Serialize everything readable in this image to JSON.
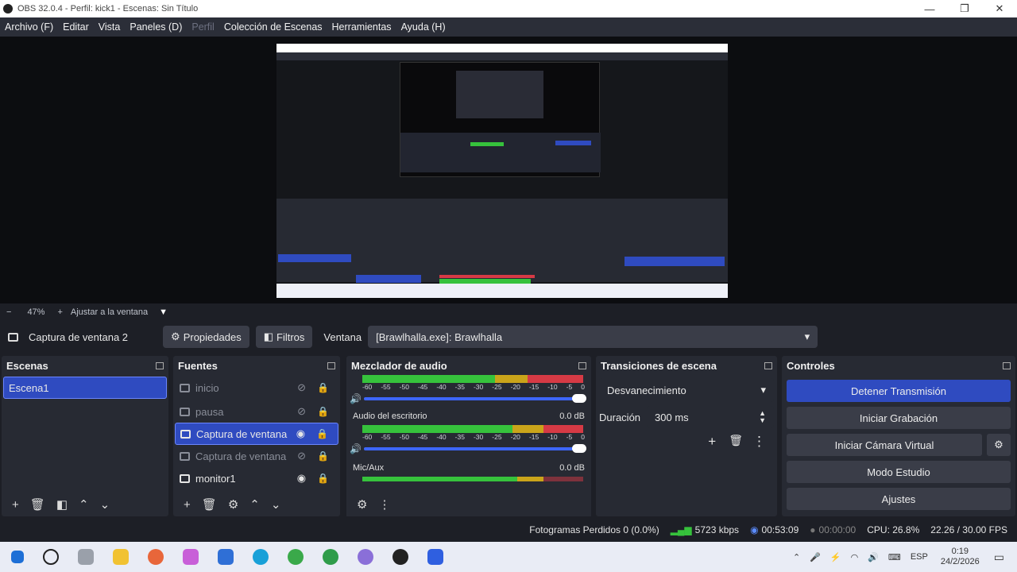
{
  "window": {
    "title": "OBS 32.0.4 - Perfil: kick1 - Escenas: Sin Título",
    "minimize": "—",
    "maximize": "❐",
    "close": "✕"
  },
  "menu": {
    "items": [
      "Archivo (F)",
      "Editar",
      "Vista",
      "Paneles (D)",
      "Perfil",
      "Colección de Escenas",
      "Herramientas",
      "Ayuda (H)"
    ]
  },
  "zoom": {
    "minus": "−",
    "value": "47%",
    "plus": "+",
    "fit_label": "Ajustar a la ventana",
    "dropdown": "▼"
  },
  "source_bar": {
    "name": "Captura de ventana 2",
    "properties": "Propiedades",
    "filters": "Filtros",
    "window_label": "Ventana",
    "window_value": "[Brawlhalla.exe]: Brawlhalla"
  },
  "scenes": {
    "title": "Escenas",
    "items": [
      "Escena1"
    ]
  },
  "sources": {
    "title": "Fuentes",
    "items": [
      {
        "name": "inicio",
        "visible": false,
        "selected": false
      },
      {
        "name": "pausa",
        "visible": false,
        "selected": false
      },
      {
        "name": "Captura de ventana",
        "visible": true,
        "selected": true
      },
      {
        "name": "Captura de ventana",
        "visible": false,
        "selected": false
      },
      {
        "name": "monitor1",
        "visible": true,
        "selected": false
      }
    ]
  },
  "mixer": {
    "title": "Mezclador de audio",
    "ticks": [
      "-60",
      "-55",
      "-50",
      "-45",
      "-40",
      "-35",
      "-30",
      "-25",
      "-20",
      "-15",
      "-10",
      "-5",
      "0"
    ],
    "channels": [
      {
        "name": "Audio del escritorio",
        "db": "0.0 dB"
      },
      {
        "name": "Mic/Aux",
        "db": "0.0 dB"
      }
    ]
  },
  "transitions": {
    "title": "Transiciones de escena",
    "selected": "Desvanecimiento",
    "duration_label": "Duración",
    "duration_value": "300 ms"
  },
  "controls": {
    "title": "Controles",
    "buttons": [
      "Detener Transmisión",
      "Iniciar Grabación",
      "Iniciar Cámara Virtual",
      "Modo Estudio",
      "Ajustes"
    ]
  },
  "status": {
    "dropped": "Fotogramas Perdidos 0 (0.0%)",
    "bitrate": "5723 kbps",
    "stream_time": "00:53:09",
    "rec_time": "00:00:00",
    "cpu": "CPU: 26.8%",
    "fps": "22.26 / 30.00 FPS"
  },
  "taskbar": {
    "lang": "ESP",
    "time": "0:19",
    "date": "24/2/2026"
  },
  "preview_mini": {
    "title": "OBS 32.0.4 - Perfil: kick1 - Escenas: Sin Título"
  },
  "colors": {
    "accent": "#2f4bc0",
    "panel": "#272a33",
    "bg": "#1d1f26",
    "meter_green": "#36c23c",
    "meter_yellow": "#caa41a",
    "meter_red": "#d63a45"
  }
}
